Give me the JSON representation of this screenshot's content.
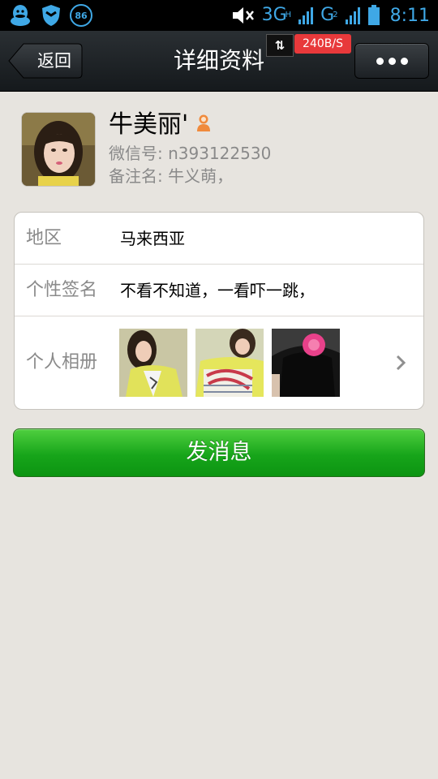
{
  "status_bar": {
    "notification_count": "86",
    "network": "3G",
    "network_sup": "H",
    "network2": "G",
    "network2_sup": "2",
    "time": "8:11",
    "accent_color": "#3fa8e6"
  },
  "header": {
    "back_label": "返回",
    "title": "详细资料",
    "speed_arrows": "⇅",
    "speed": "240B/S",
    "more_icon": "ellipsis-icon"
  },
  "profile": {
    "nickname": "牛美丽'",
    "wechat_id": "微信号: n393122530",
    "remark": "备注名: 牛义萌，",
    "gender": "female"
  },
  "details": {
    "region_label": "地区",
    "region_value": "马来西亚",
    "signature_label": "个性签名",
    "signature_value": "不看不知道，一看吓一跳，",
    "album_label": "个人相册"
  },
  "actions": {
    "send_message_label": "发消息",
    "send_color": "#17a51a"
  }
}
